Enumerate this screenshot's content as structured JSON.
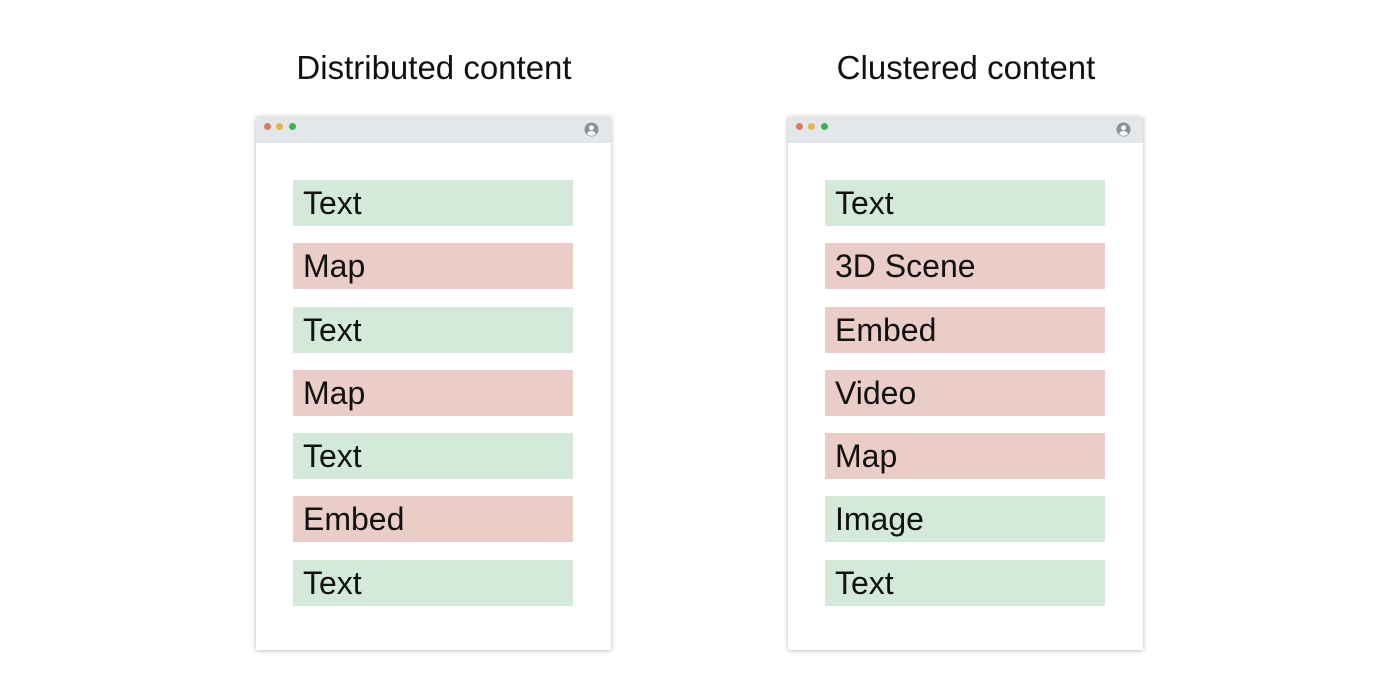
{
  "colors": {
    "green_block": "#d3eadb",
    "red_block": "#ebcdc8",
    "dot_red": "#e07a5f",
    "dot_yellow": "#e8b54a",
    "dot_green": "#3bb54a",
    "avatar": "#8a9299"
  },
  "panels": [
    {
      "title": "Distributed content",
      "blocks": [
        {
          "label": "Text",
          "kind": "green"
        },
        {
          "label": "Map",
          "kind": "red"
        },
        {
          "label": "Text",
          "kind": "green"
        },
        {
          "label": "Map",
          "kind": "red"
        },
        {
          "label": "Text",
          "kind": "green"
        },
        {
          "label": "Embed",
          "kind": "red"
        },
        {
          "label": "Text",
          "kind": "green"
        }
      ]
    },
    {
      "title": "Clustered content",
      "blocks": [
        {
          "label": "Text",
          "kind": "green"
        },
        {
          "label": "3D Scene",
          "kind": "red"
        },
        {
          "label": "Embed",
          "kind": "red"
        },
        {
          "label": "Video",
          "kind": "red"
        },
        {
          "label": "Map",
          "kind": "red"
        },
        {
          "label": "Image",
          "kind": "green"
        },
        {
          "label": "Text",
          "kind": "green"
        }
      ]
    }
  ]
}
